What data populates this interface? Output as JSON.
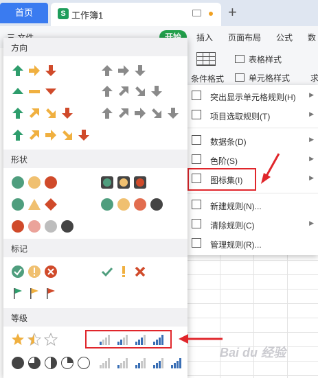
{
  "tabbar": {
    "home_label": "首页",
    "doc_title": "工作簿1",
    "doc_icon_letter": "S"
  },
  "ribbon": {
    "tabs": [
      "三 文件",
      "开始",
      "插入",
      "页面布局",
      "公式",
      "数"
    ],
    "tools": {
      "cond_format": "条件格式",
      "table_style": "表格样式",
      "cell_style": "单元格样式",
      "sum": "求"
    }
  },
  "cf_menu": {
    "items": [
      {
        "label": "突出显示单元格规则(H)",
        "has_submenu": true
      },
      {
        "label": "项目选取规则(T)",
        "has_submenu": true
      },
      {
        "label": "数据条(D)",
        "has_submenu": true
      },
      {
        "label": "色阶(S)",
        "has_submenu": true
      },
      {
        "label": "图标集(I)",
        "has_submenu": true
      },
      {
        "label": "新建规则(N)...",
        "has_submenu": false
      },
      {
        "label": "清除规则(C)",
        "has_submenu": true
      },
      {
        "label": "管理规则(R)...",
        "has_submenu": false
      }
    ]
  },
  "iconset_panel": {
    "sections": [
      "方向",
      "形状",
      "标记",
      "等级"
    ]
  },
  "watermark": "Bai du 经验",
  "colors": {
    "accent": "#3a7bf0",
    "green": "#1e9d5b",
    "highlight_red": "#e0262b",
    "arrow_green": "#2e9d6c",
    "arrow_orange": "#f0b040",
    "arrow_red": "#d04a2a",
    "gray": "#8a8a8a"
  }
}
